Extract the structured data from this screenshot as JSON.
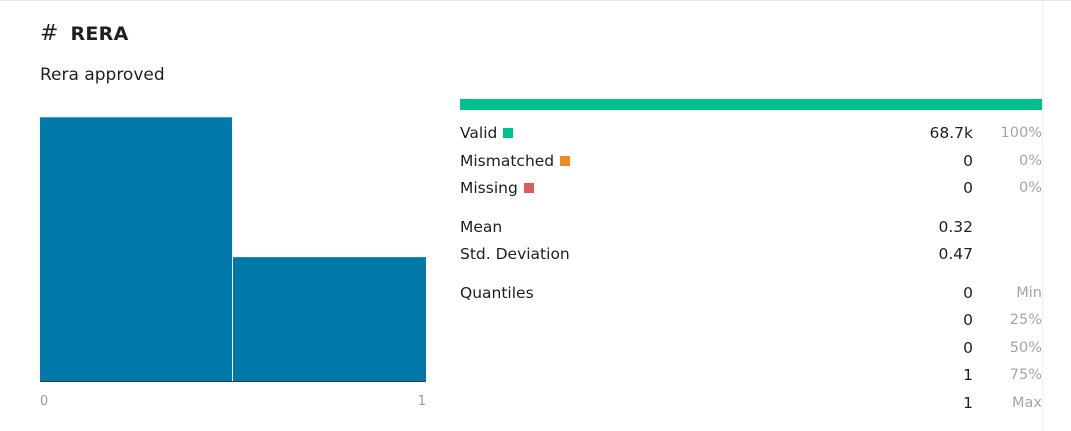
{
  "column": {
    "icon": "hash-icon",
    "name": "RERA",
    "description": "Rera approved"
  },
  "colors": {
    "bar": "#0079a8",
    "valid": "#00c08b",
    "mismatched": "#f08a24",
    "missing": "#de5b5b"
  },
  "chart_data": {
    "type": "bar",
    "categories": [
      "0",
      "1"
    ],
    "values": [
      68.0,
      32.0
    ],
    "value_unit": "percent of rows",
    "x_tick_labels": [
      "0",
      "1"
    ],
    "xlim": [
      0,
      1
    ],
    "ylim": [
      0,
      70
    ],
    "title": "",
    "xlabel": "",
    "ylabel": "",
    "grid": false
  },
  "stats": {
    "valid": {
      "label": "Valid",
      "value": "68.7k",
      "pct": "100%",
      "fraction": 1.0
    },
    "mismatched": {
      "label": "Mismatched",
      "value": "0",
      "pct": "0%"
    },
    "missing": {
      "label": "Missing",
      "value": "0",
      "pct": "0%"
    },
    "mean": {
      "label": "Mean",
      "value": "0.32"
    },
    "std": {
      "label": "Std. Deviation",
      "value": "0.47"
    },
    "quantiles": {
      "label": "Quantiles",
      "items": [
        {
          "value": "0",
          "label": "Min"
        },
        {
          "value": "0",
          "label": "25%"
        },
        {
          "value": "0",
          "label": "50%"
        },
        {
          "value": "1",
          "label": "75%"
        },
        {
          "value": "1",
          "label": "Max"
        }
      ]
    }
  }
}
